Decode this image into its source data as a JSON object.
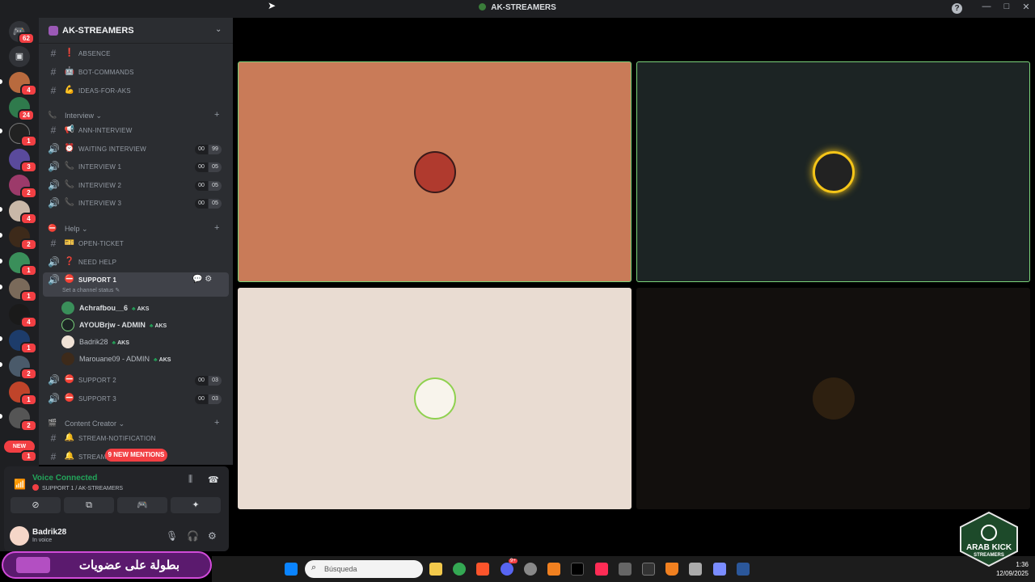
{
  "window": {
    "title": "AK-STREAMERS",
    "help": "?",
    "minimize": "—",
    "maximize": "□",
    "close": "✕"
  },
  "rail": {
    "home_badge": "62",
    "badges": [
      "4",
      "24",
      "1",
      "3",
      "2",
      "4",
      "2",
      "1",
      "1",
      "4",
      "1",
      "2",
      "1",
      "2"
    ],
    "new_label": "NEW",
    "new_badge": "1"
  },
  "server": {
    "name": "AK-STREAMERS",
    "chevron": "⌄"
  },
  "channels_top": [
    {
      "emoji": "❗",
      "label": "ABSENCE"
    },
    {
      "emoji": "🤖",
      "label": "BOT-COMMANDS"
    },
    {
      "emoji": "💪",
      "label": "IDEAS-FOR-AKS"
    }
  ],
  "cat_interview": {
    "label": "Interview",
    "chev": "⌄",
    "plus": "+"
  },
  "interview_channels": [
    {
      "emoji": "📢",
      "label": "ANN-INTERVIEW",
      "c1": "",
      "c2": ""
    },
    {
      "emoji": "⏰",
      "label": "WAITING INTERVIEW",
      "c1": "00",
      "c2": "99"
    },
    {
      "emoji": "📞",
      "label": "INTERVIEW 1",
      "c1": "00",
      "c2": "05"
    },
    {
      "emoji": "📞",
      "label": "INTERVIEW 2",
      "c1": "00",
      "c2": "05"
    },
    {
      "emoji": "📞",
      "label": "INTERVIEW 3",
      "c1": "00",
      "c2": "05"
    }
  ],
  "cat_help": {
    "label": "Help",
    "chev": "⌄",
    "plus": "+"
  },
  "help_channels": [
    {
      "emoji": "🎫",
      "label": "OPEN-TICKET"
    },
    {
      "emoji": "❓",
      "label": "NEED HELP"
    }
  ],
  "support1": {
    "label": "SUPPORT 1",
    "status": "Set a channel status ✎",
    "icons": "💬 ⚙"
  },
  "members": [
    {
      "name": "Achrafbou__6",
      "tag": "AKS"
    },
    {
      "name": "AYOUBrjw - ADMIN",
      "tag": "AKS"
    },
    {
      "name": "Badrik28",
      "tag": "AKS"
    },
    {
      "name": "Marouane09 - ADMIN",
      "tag": "AKS"
    }
  ],
  "support_more": [
    {
      "label": "SUPPORT 2",
      "c1": "00",
      "c2": "03"
    },
    {
      "label": "SUPPORT 3",
      "c1": "00",
      "c2": "03"
    }
  ],
  "cat_content": {
    "label": "Content Creator",
    "chev": "⌄",
    "plus": "+"
  },
  "content_channels": [
    {
      "emoji": "🔔",
      "label": "STREAM-NOTIFICATION"
    },
    {
      "emoji": "🔔",
      "label": "STREAM"
    }
  ],
  "mentions": "9 NEW MENTIONS",
  "voice": {
    "status": "Voice Connected",
    "location": "SUPPORT 1 / AK-STREAMERS"
  },
  "user": {
    "name": "Badrik28",
    "status": "In voice"
  },
  "tiles": [
    {
      "bg": "#c97b58",
      "border": "#7bd37b"
    },
    {
      "bg": "#1c2424",
      "border": "#7bd37b"
    },
    {
      "bg": "#e9dcd2",
      "border": "#e9dcd2"
    },
    {
      "bg": "#120f0d",
      "border": "#120f0d"
    }
  ],
  "banner": {
    "text": "بطولة على عضويات"
  },
  "taskbar": {
    "search_placeholder": "Búsqueda",
    "discord_badge": "9+"
  },
  "clock": {
    "time": "1:36",
    "date": "12/09/2025"
  },
  "logo": {
    "line1": "ARAB KICK",
    "line2": "STREAMERS"
  }
}
